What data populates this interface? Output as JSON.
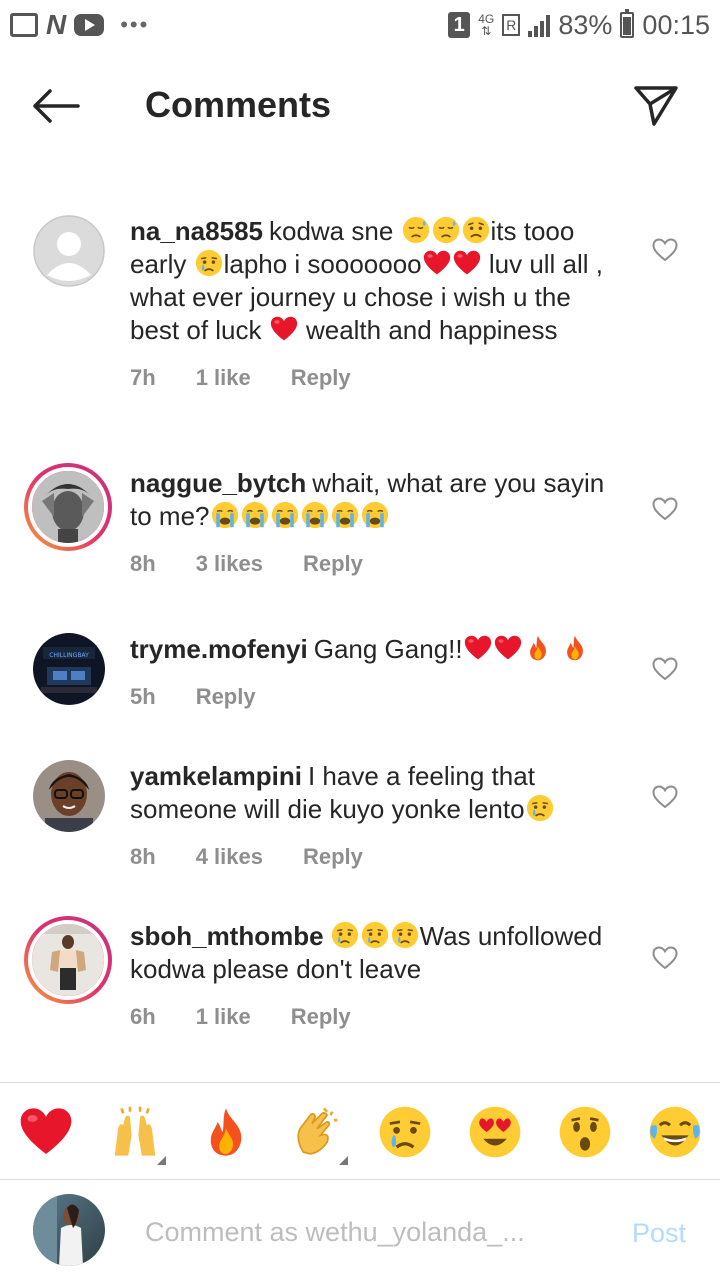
{
  "status_bar": {
    "notification_count": "1",
    "network_type": "4G",
    "roaming": "R",
    "battery": "83%",
    "time": "00:15"
  },
  "header": {
    "title": "Comments",
    "back_icon": "arrow-left-icon",
    "send_icon": "paper-plane-icon"
  },
  "comments": [
    {
      "username": "na_na8585",
      "segments": [
        {
          "t": "text",
          "v": "kodwa sne "
        },
        {
          "t": "emoji",
          "v": "sad-sweat"
        },
        {
          "t": "emoji",
          "v": "sad-sweat"
        },
        {
          "t": "emoji",
          "v": "worried"
        },
        {
          "t": "text",
          "v": "its tooo early "
        },
        {
          "t": "emoji",
          "v": "crying"
        },
        {
          "t": "text",
          "v": "lapho i sooooooo"
        },
        {
          "t": "emoji",
          "v": "heart"
        },
        {
          "t": "emoji",
          "v": "heart"
        },
        {
          "t": "text",
          "v": " luv ull all , what ever journey u chose i wish u the best of luck "
        },
        {
          "t": "emoji",
          "v": "heart"
        },
        {
          "t": "text",
          "v": " wealth and happiness"
        }
      ],
      "time": "7h",
      "likes": "1 like",
      "reply": "Reply",
      "avatar": "default"
    },
    {
      "username": "naggue_bytch",
      "segments": [
        {
          "t": "text",
          "v": "whait, what are you sayin to me?"
        },
        {
          "t": "emoji",
          "v": "loud-cry"
        },
        {
          "t": "emoji",
          "v": "loud-cry"
        },
        {
          "t": "emoji",
          "v": "loud-cry"
        },
        {
          "t": "emoji",
          "v": "loud-cry"
        },
        {
          "t": "emoji",
          "v": "loud-cry"
        },
        {
          "t": "emoji",
          "v": "loud-cry"
        }
      ],
      "time": "8h",
      "likes": "3 likes",
      "reply": "Reply",
      "avatar": "photo-bw"
    },
    {
      "username": "tryme.mofenyi",
      "segments": [
        {
          "t": "text",
          "v": "Gang Gang!!"
        },
        {
          "t": "emoji",
          "v": "heart"
        },
        {
          "t": "emoji",
          "v": "heart"
        },
        {
          "t": "emoji",
          "v": "fire"
        },
        {
          "t": "text",
          "v": " "
        },
        {
          "t": "emoji",
          "v": "fire"
        }
      ],
      "time": "5h",
      "likes": "",
      "reply": "Reply",
      "avatar": "photo-dark"
    },
    {
      "username": "yamkelampini",
      "segments": [
        {
          "t": "text",
          "v": "I have a feeling that someone will die kuyo yonke lento"
        },
        {
          "t": "emoji",
          "v": "crying"
        }
      ],
      "time": "8h",
      "likes": "4 likes",
      "reply": "Reply",
      "avatar": "photo-face"
    },
    {
      "username": "sboh_mthombe",
      "segments": [
        {
          "t": "emoji",
          "v": "crying"
        },
        {
          "t": "emoji",
          "v": "crying"
        },
        {
          "t": "emoji",
          "v": "crying"
        },
        {
          "t": "text",
          "v": "Was unfollowed kodwa please don't leave"
        }
      ],
      "time": "6h",
      "likes": "1 like",
      "reply": "Reply",
      "avatar": "photo-light"
    }
  ],
  "reactions": [
    {
      "emoji": "heart",
      "name": "heart-reaction"
    },
    {
      "emoji": "raised-hands",
      "name": "raised-hands-reaction"
    },
    {
      "emoji": "fire",
      "name": "fire-reaction"
    },
    {
      "emoji": "clap",
      "name": "clapping-hands-reaction"
    },
    {
      "emoji": "crying",
      "name": "crying-face-reaction"
    },
    {
      "emoji": "heart-eyes",
      "name": "heart-eyes-reaction"
    },
    {
      "emoji": "surprised",
      "name": "surprised-face-reaction"
    },
    {
      "emoji": "joy",
      "name": "tears-of-joy-reaction"
    }
  ],
  "composer": {
    "placeholder": "Comment as wethu_yolanda_...",
    "post_label": "Post"
  },
  "colors": {
    "text": "#262626",
    "meta": "#8e8e8e",
    "post_disabled": "#b3dbff",
    "like_heart": "#ed4956"
  }
}
